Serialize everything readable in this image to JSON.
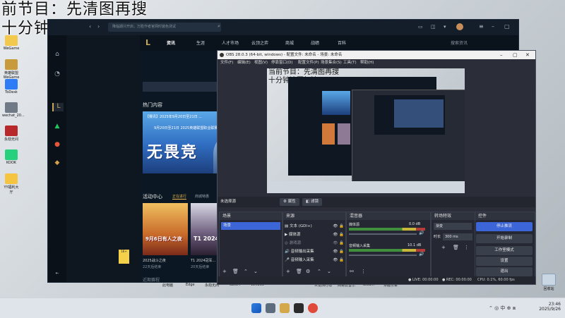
{
  "overlay": {
    "line1": "前节目：先清图再搜",
    "line2": "十分钟清图打法"
  },
  "desktop": {
    "icons": [
      {
        "label": "WeGame",
        "color": "#f2c94c"
      },
      {
        "label": "英雄联盟 WeGame版",
        "color": "#c79a3c"
      },
      {
        "label": "ToDesk",
        "color": "#2d7cf6"
      },
      {
        "label": "wechat_20...",
        "color": "#6f7a86"
      },
      {
        "label": "永劫无间",
        "color": "#b8282a"
      },
      {
        "label": "KOOK",
        "color": "#26d07c"
      },
      {
        "label": "YY福利大厅",
        "color": "#f5c542"
      }
    ],
    "right_icon_label": "回收站"
  },
  "wegame": {
    "search_placeholder": "降临期只开启，万胜作者官网时装色测试",
    "side_icons": [
      "store-icon",
      "history-icon",
      "lol-icon",
      "triangle-game-icon",
      "game-icon-1",
      "game-icon-2"
    ],
    "nav": [
      "资讯",
      "生涯",
      "人才市场",
      "云顶之弈",
      "商城",
      "战绩",
      "百科"
    ],
    "search_hint": "搜索资讯",
    "hot_title": "热门内容",
    "promo_caption": "【赛讯】2025年9月20日至21日 ...",
    "promo_date": "9月20日至21日 2025英雄联盟职业联赛",
    "promo_big": "无畏竞",
    "activity_title": "活动中心",
    "activity_tabs": [
      "正在进行",
      "商城特惠"
    ],
    "card1_title": "9月6日有人之夜",
    "card1_sub": "2025战斗之夜",
    "card1_date": "22天后结束",
    "card2_title": "T1 2024...",
    "card2_sub": "T1 2024冠军...",
    "card2_date": "20天后结束",
    "bottom_label": "近期赛程",
    "dock_labels": [
      "此电脑",
      "Edge",
      "永劫无间",
      "obs64",
      "Win365",
      "三角洲行动",
      "网易云音乐",
      "Steam",
      "穿越引擎"
    ]
  },
  "obs": {
    "title": "OBS 28.0.3 (64-bit, windows) - 配置文件: 未命名 - 场景: 未命名",
    "menu": [
      "文件(F)",
      "编辑(E)",
      "视图(V)",
      "停靠窗口(D)",
      "配置文件(P)",
      "场景集合(S)",
      "工具(T)",
      "帮助(H)"
    ],
    "preview_overlay1": "当前节目：先清图再搜",
    "preview_overlay2": "十分钟清图打法",
    "source_bar_label": "未选择源",
    "props_button": "属性",
    "filters_button": "滤镜",
    "scenes_title": "场景",
    "scene_item": "场景",
    "sources_title": "来源",
    "sources": [
      "文本 (GDI+)",
      "媒体源",
      "游戏源",
      "音频输出采集",
      "音频输入采集"
    ],
    "mixer_title": "混音器",
    "mixer": [
      {
        "name": "媒体源",
        "db": "0.0 dB"
      },
      {
        "name": "音频输入采集",
        "db": "10.1 dB"
      }
    ],
    "trans_title": "转场特效",
    "trans_value": "渐变",
    "duration_label": "时长",
    "duration_value": "300 ms",
    "controls_title": "控件",
    "controls": [
      "停止推流",
      "开始录制",
      "工作室模式",
      "设置",
      "退出"
    ],
    "status": {
      "live": "LIVE: 00:00:00",
      "rec": "REC: 00:00:00",
      "cpu": "CPU: 0.1%, 60.00 fps"
    }
  },
  "taskbar": {
    "time": "23:46",
    "date": "2025/9/26",
    "lang": "中",
    "tray": "⌃ ◎ 中 ⊕ ⧈"
  }
}
